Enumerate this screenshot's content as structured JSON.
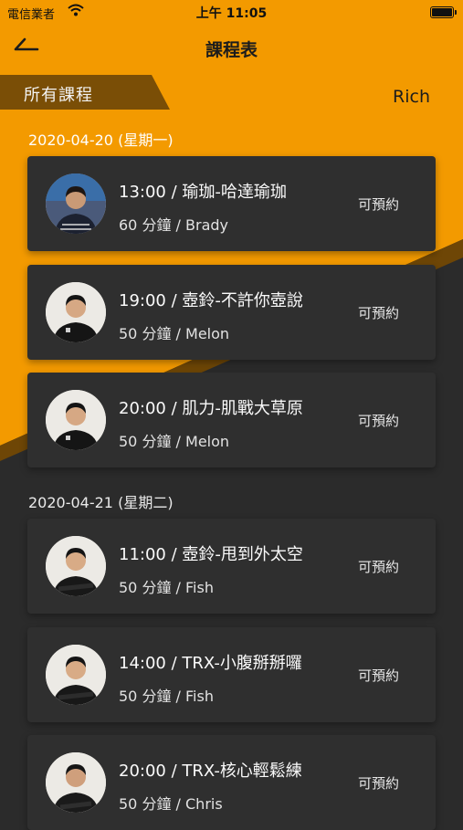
{
  "status_bar": {
    "carrier": "電信業者",
    "time": "上午 11:05"
  },
  "nav": {
    "title": "課程表",
    "back_icon": "back-arrow-icon"
  },
  "filter": {
    "label": "所有課程"
  },
  "user": {
    "name": "Rich"
  },
  "colors": {
    "accent": "#f39a00",
    "dark_bg": "#2b2b2b",
    "card_bg": "#2f2f2f",
    "badge": "#7a4e06"
  },
  "days": [
    {
      "date": "2020-04-20 (星期一)",
      "classes": [
        {
          "title": "13:00 / 瑜珈-哈達瑜珈",
          "detail": "60 分鐘 / Brady",
          "status": "可預約"
        },
        {
          "title": "19:00 / 壺鈴-不許你壺說",
          "detail": "50 分鐘 / Melon",
          "status": "可預約"
        },
        {
          "title": "20:00 / 肌力-肌戰大草原",
          "detail": "50 分鐘 / Melon",
          "status": "可預約"
        }
      ]
    },
    {
      "date": "2020-04-21 (星期二)",
      "classes": [
        {
          "title": "11:00 / 壺鈴-甩到外太空",
          "detail": "50 分鐘 / Fish",
          "status": "可預約"
        },
        {
          "title": "14:00 / TRX-小腹掰掰囉",
          "detail": "50 分鐘 / Fish",
          "status": "可預約"
        },
        {
          "title": "20:00 / TRX-核心輕鬆練",
          "detail": "50 分鐘 / Chris",
          "status": "可預約"
        }
      ]
    }
  ]
}
